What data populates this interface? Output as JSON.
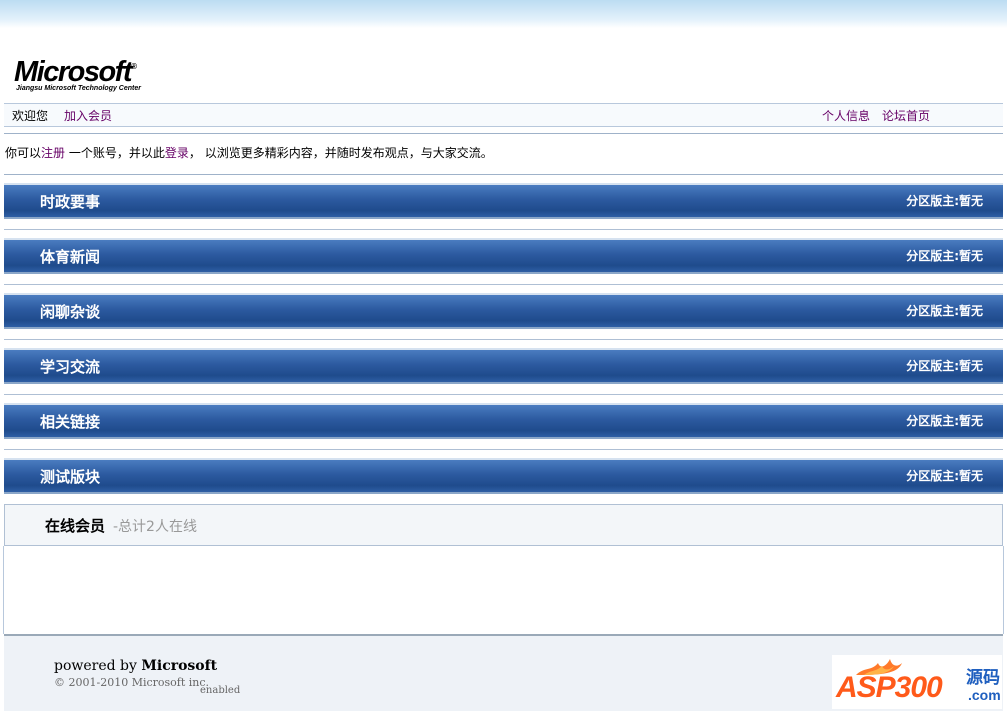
{
  "logo": {
    "main": "Microsoft",
    "mark": "®",
    "sub": "Jiangsu Microsoft Technology Center"
  },
  "nav": {
    "welcome": "欢迎您",
    "join": "加入会员",
    "profile": "个人信息",
    "home": "论坛首页"
  },
  "notice": {
    "prefix": "你可以",
    "register": "注册",
    "middle": " 一个账号，并以此",
    "login": "登录",
    "suffix": "， 以浏览更多精彩内容，并随时发布观点，与大家交流。"
  },
  "categories": [
    {
      "title": "时政要事",
      "moderator": "分区版主:暂无"
    },
    {
      "title": "体育新闻",
      "moderator": "分区版主:暂无"
    },
    {
      "title": "闲聊杂谈",
      "moderator": "分区版主:暂无"
    },
    {
      "title": "学习交流",
      "moderator": "分区版主:暂无"
    },
    {
      "title": "相关链接",
      "moderator": "分区版主:暂无"
    },
    {
      "title": "测试版块",
      "moderator": "分区版主:暂无"
    }
  ],
  "online": {
    "title": "在线会员",
    "count_text": "-总计2人在线"
  },
  "footer": {
    "powered_prefix": "powered by ",
    "powered_brand": "Microsoft",
    "copyright": "© 2001-2010 Microsoft inc.",
    "enabled": "enabled"
  },
  "badge": {
    "asp": "ASP300",
    "cn": "源码",
    "com": ".com"
  }
}
